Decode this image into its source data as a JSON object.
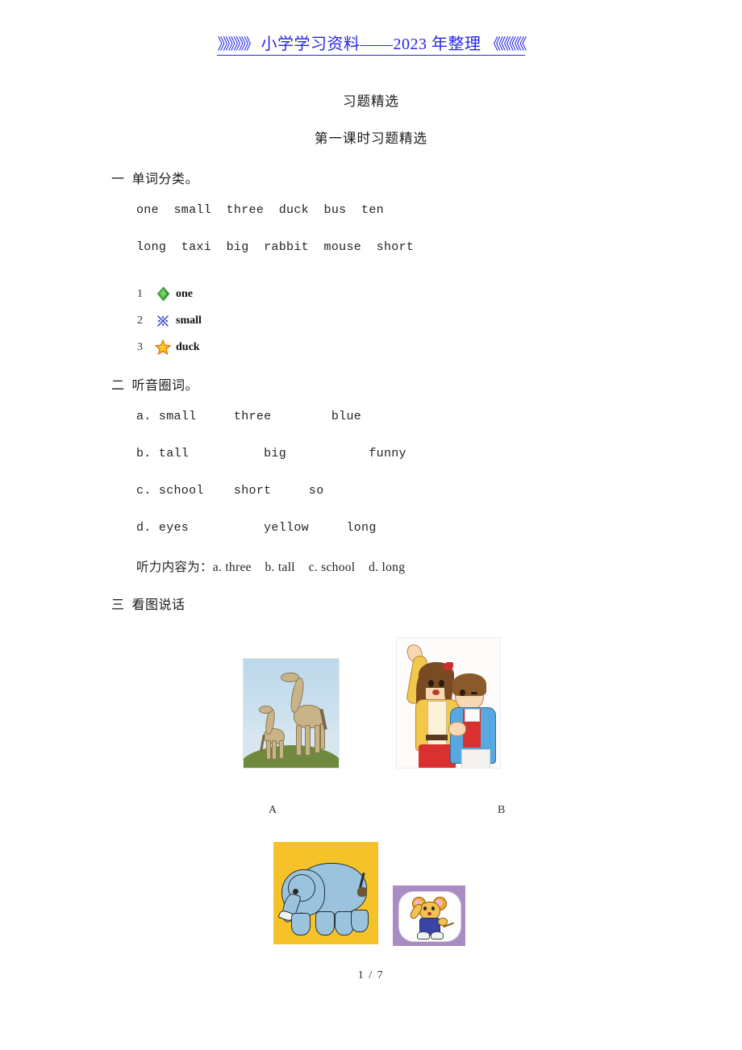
{
  "header": {
    "left_chevrons": "》》》》》》",
    "text": " 小学学习资料——2023 年整理 ",
    "right_chevrons": "《《《《《《",
    "color": "#2626e8"
  },
  "title": "习题精选",
  "subtitle": "第一课时习题精选",
  "sections": [
    {
      "number": "一",
      "heading": "单词分类。",
      "word_rows": [
        "one  small  three  duck  bus  ten",
        "long  taxi  big  rabbit  mouse  short"
      ],
      "classify_items": [
        {
          "index": "1",
          "icon": "green-diamond-icon",
          "label": "one",
          "color": "#3fa535"
        },
        {
          "index": "2",
          "icon": "blue-sparkle-icon",
          "label": "small",
          "color": "#2f3fd0"
        },
        {
          "index": "3",
          "icon": "orange-star-icon",
          "label": "duck",
          "color": "#f5a300"
        }
      ]
    },
    {
      "number": "二",
      "heading": "听音圈词。",
      "choice_rows": [
        "a. small     three        blue",
        "b. tall          big           funny",
        "c. school    short     so",
        "d. eyes          yellow     long"
      ],
      "answer_line": "听力内容为：a. three    b. tall    c. school    d. long"
    },
    {
      "number": "三",
      "heading": "看图说话",
      "pictures": [
        {
          "name": "giraffes-photo",
          "label": "A"
        },
        {
          "name": "two-girls-illustration",
          "label": "B"
        },
        {
          "name": "elephant-cartoon",
          "label": ""
        },
        {
          "name": "mouse-cartoon",
          "label": ""
        }
      ]
    }
  ],
  "footer": "1 / 7"
}
